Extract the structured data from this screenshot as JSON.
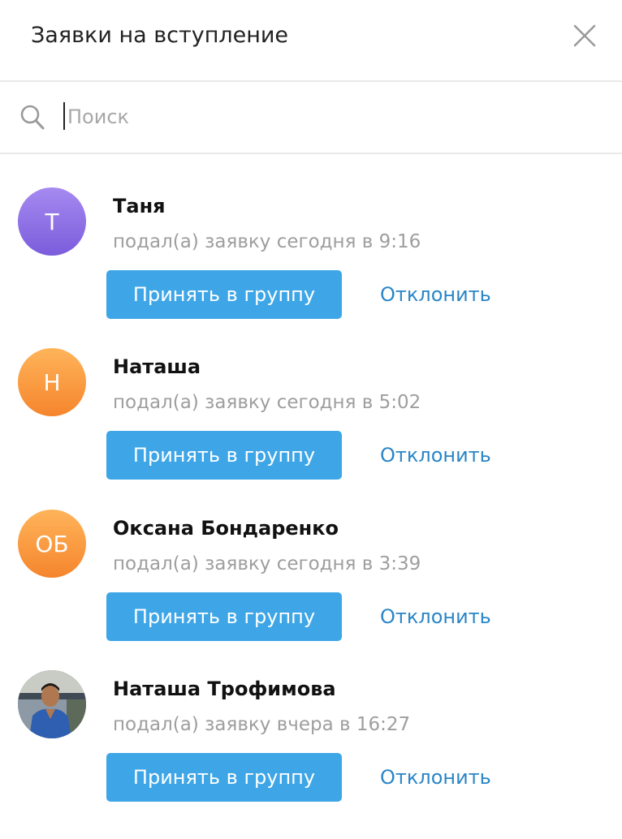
{
  "dialog": {
    "title": "Заявки на вступление",
    "close_icon": "close-icon"
  },
  "search": {
    "placeholder": "Поиск",
    "value": "",
    "icon": "search-icon"
  },
  "colors": {
    "accept_button": "#3ea6e6",
    "decline_link": "#2a86c7",
    "status_text": "#9e9e9e"
  },
  "requests": [
    {
      "name": "Таня",
      "initials": "Т",
      "avatar_color": "purple",
      "status": "подал(а) заявку сегодня в 9:16",
      "accept_label": "Принять в группу",
      "decline_label": "Отклонить"
    },
    {
      "name": "Наташа",
      "initials": "Н",
      "avatar_color": "orange",
      "status": "подал(а) заявку сегодня в 5:02",
      "accept_label": "Принять в группу",
      "decline_label": "Отклонить"
    },
    {
      "name": "Оксана Бондаренко",
      "initials": "ОБ",
      "avatar_color": "orange",
      "status": "подал(а) заявку сегодня в 3:39",
      "accept_label": "Принять в группу",
      "decline_label": "Отклонить"
    },
    {
      "name": "Наташа Трофимова",
      "initials": "",
      "avatar_color": "photo",
      "status": "подал(а) заявку вчера в 16:27",
      "accept_label": "Принять в группу",
      "decline_label": "Отклонить"
    }
  ]
}
